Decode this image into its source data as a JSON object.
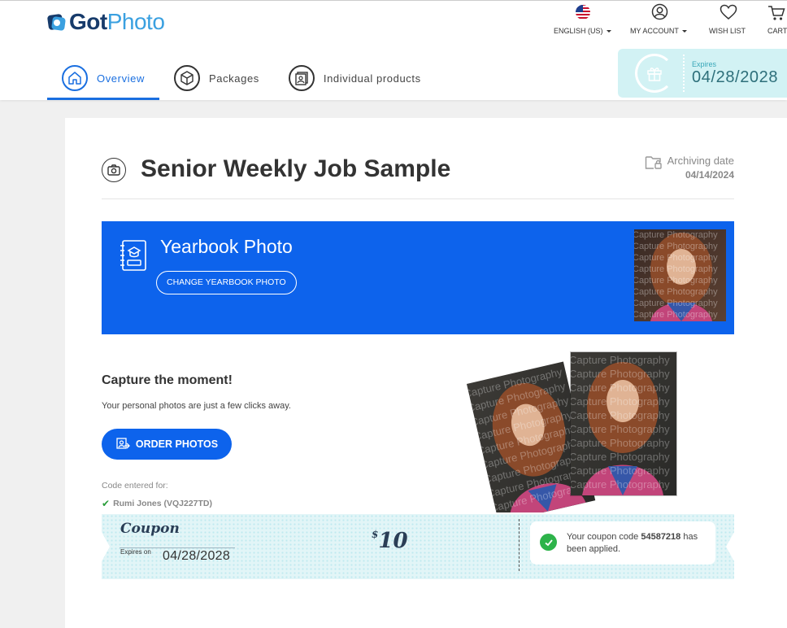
{
  "brand": {
    "got": "Got",
    "photo": "Photo"
  },
  "top_nav": {
    "language": "ENGLISH (US)",
    "account": "MY ACCOUNT",
    "wishlist": "WISH LIST",
    "cart": "CART"
  },
  "tabs": [
    {
      "label": "Overview",
      "icon": "home-icon",
      "active": true
    },
    {
      "label": "Packages",
      "icon": "box-icon",
      "active": false
    },
    {
      "label": "Individual products",
      "icon": "photos-icon",
      "active": false
    }
  ],
  "expiry": {
    "label": "Expires",
    "date": "04/28/2028",
    "icon": "gift-icon"
  },
  "job": {
    "title": "Senior Weekly Job Sample",
    "archive_label": "Archiving date",
    "archive_date": "04/14/2024"
  },
  "yearbook": {
    "title": "Yearbook Photo",
    "change_button": "CHANGE YEARBOOK PHOTO"
  },
  "cta": {
    "title": "Capture the moment!",
    "subtitle": "Your personal photos are just a few clicks away.",
    "order_button": "ORDER PHOTOS",
    "code_label": "Code entered for:",
    "code_value": "Rumi Jones (VQJ227TD)"
  },
  "watermark": "Capture Photography",
  "coupon": {
    "title": "Coupon",
    "expires_label": "Expires on",
    "expires_date": "04/28/2028",
    "amount_prefix": "$",
    "amount": "10",
    "message_pre": "Your coupon code ",
    "code": "54587218",
    "message_post": " has been applied."
  },
  "colors": {
    "primary": "#0d63ec",
    "accent_tab": "#1a6fe0",
    "expiry_bg": "#d2f2f4",
    "coupon_bg": "#e2f5f7",
    "success": "#2db34a"
  }
}
